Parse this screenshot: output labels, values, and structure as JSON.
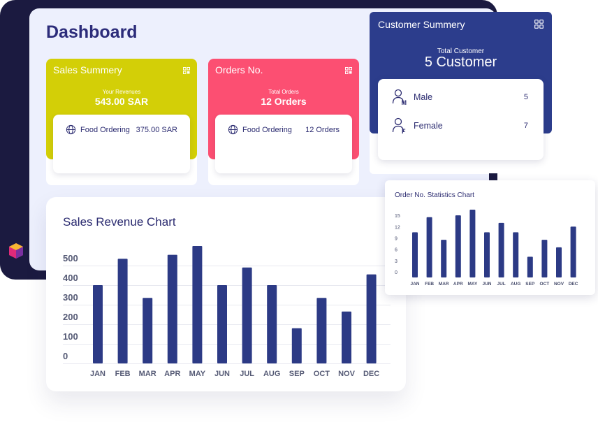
{
  "page_title": "Dashboard",
  "colors": {
    "sales": "#d3cf07",
    "orders": "#fc4f72",
    "customer": "#2c3d8c",
    "bar": "#2c3a85",
    "frame": "#1b1a40"
  },
  "icons": {
    "grid": "grid-icon",
    "globe": "globe-icon",
    "male": "male-user-icon",
    "female": "female-user-icon",
    "logo": "app-logo-icon"
  },
  "sales_summary": {
    "title": "Sales Summery",
    "subtitle": "Your Revenues",
    "total": "543.00 SAR",
    "item": {
      "label": "Food Ordering",
      "value": "375.00 SAR"
    }
  },
  "orders": {
    "title": "Orders No.",
    "subtitle": "Total Orders",
    "total": "12 Orders",
    "item": {
      "label": "Food Ordering",
      "value": "12 Orders"
    }
  },
  "customer_summary": {
    "title": "Customer Summery",
    "subtitle": "Total Customer",
    "total": "5 Customer",
    "rows": [
      {
        "label": "Male",
        "value": "5"
      },
      {
        "label": "Female",
        "value": "7"
      }
    ]
  },
  "chart_data": [
    {
      "type": "bar",
      "title": "Sales Revenue Chart",
      "categories": [
        "JAN",
        "FEB",
        "MAR",
        "APR",
        "MAY",
        "JUN",
        "JUL",
        "AUG",
        "SEP",
        "OCT",
        "NOV",
        "DEC"
      ],
      "values": [
        400,
        535,
        335,
        555,
        600,
        400,
        490,
        400,
        180,
        335,
        265,
        455
      ],
      "yticks": [
        0,
        100,
        200,
        300,
        400,
        500
      ],
      "ylim": [
        0,
        600
      ],
      "grid": true
    },
    {
      "type": "bar",
      "title": "Order No. Statistics Chart",
      "categories": [
        "JAN",
        "FEB",
        "MAR",
        "APR",
        "MAY",
        "JUN",
        "JUL",
        "AUG",
        "SEP",
        "OCT",
        "NOV",
        "DEC"
      ],
      "values": [
        12,
        16,
        10,
        16.5,
        18,
        12,
        14.5,
        12,
        5.5,
        10,
        8,
        13.5
      ],
      "yticks": [
        0,
        3,
        6,
        9,
        12,
        15
      ],
      "ylim": [
        0,
        18
      ],
      "grid": false
    }
  ]
}
